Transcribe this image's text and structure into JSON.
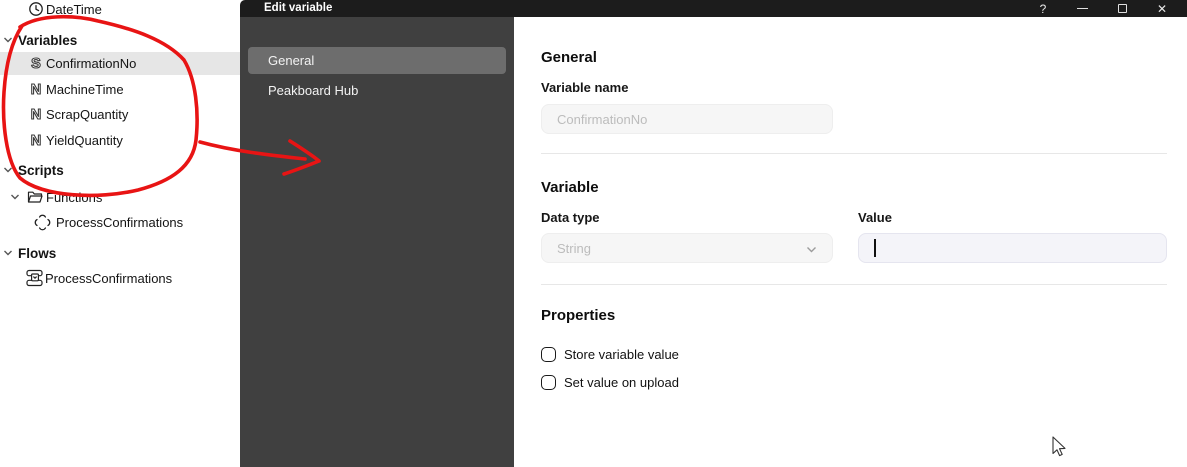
{
  "colors": {
    "annotation_red": "#e81414",
    "titlebar": "#1c1c1c",
    "dialog_sidebar": "#404040",
    "selected_nav_item": "#6d6d6d",
    "selected_tree_row": "#e6e6e6",
    "focused_field_bg": "#f4f4f9"
  },
  "tree": {
    "items": [
      {
        "label": "DateTime",
        "icon": "clock-icon"
      },
      {
        "label": "Variables",
        "icon": "chevron-down-icon",
        "type": "group-header"
      },
      {
        "label": "ConfirmationNo",
        "icon": "string-type-icon",
        "selected": true
      },
      {
        "label": "MachineTime",
        "icon": "number-type-icon"
      },
      {
        "label": "ScrapQuantity",
        "icon": "number-type-icon"
      },
      {
        "label": "YieldQuantity",
        "icon": "number-type-icon"
      },
      {
        "label": "Scripts",
        "icon": "chevron-down-icon",
        "type": "group-header"
      },
      {
        "label": "Functions",
        "icon": "folder-icon"
      },
      {
        "label": "ProcessConfirmations",
        "icon": "function-icon"
      },
      {
        "label": "Flows",
        "icon": "chevron-down-icon",
        "type": "group-header"
      },
      {
        "label": "ProcessConfirmations",
        "icon": "flow-icon"
      }
    ]
  },
  "dialog": {
    "title": "Edit variable",
    "controls": {
      "help": "?",
      "close": "✕"
    },
    "nav": {
      "items": [
        {
          "label": "General",
          "selected": true
        },
        {
          "label": "Peakboard Hub",
          "selected": false
        }
      ]
    },
    "general": {
      "heading": "General",
      "name_label": "Variable name",
      "name_value": "ConfirmationNo"
    },
    "variable": {
      "heading": "Variable",
      "datatype_label": "Data type",
      "datatype_value": "String",
      "value_label": "Value",
      "value_text": ""
    },
    "properties": {
      "heading": "Properties",
      "items": [
        {
          "label": "Store variable value",
          "checked": false
        },
        {
          "label": "Set value on upload",
          "checked": false
        }
      ]
    }
  }
}
